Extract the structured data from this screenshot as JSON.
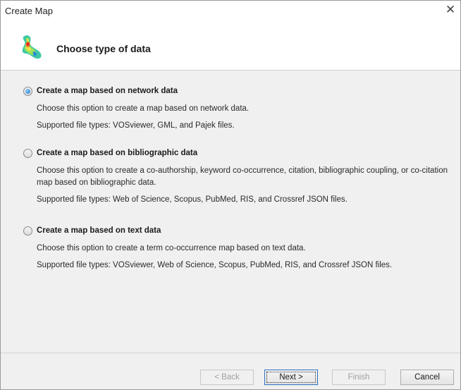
{
  "window": {
    "title": "Create Map",
    "close_glyph": "✕"
  },
  "header": {
    "title": "Choose type of data",
    "icon": "vosviewer-density-icon"
  },
  "options": [
    {
      "label": "Create a map based on network data",
      "checked": true,
      "description": "Choose this option to create a map based on network data.",
      "supported": "Supported file types: VOSviewer, GML, and Pajek files."
    },
    {
      "label": "Create a map based on bibliographic data",
      "checked": false,
      "description": "Choose this option to create a co-authorship, keyword co-occurrence, citation, bibliographic coupling, or co-citation map based on bibliographic data.",
      "supported": "Supported file types: Web of Science, Scopus, PubMed, RIS, and Crossref JSON files."
    },
    {
      "label": "Create a map based on text data",
      "checked": false,
      "description": "Choose this option to create a term co-occurrence map based on text data.",
      "supported": "Supported file types: VOSviewer, Web of Science, Scopus, PubMed, RIS, and Crossref JSON files."
    }
  ],
  "buttons": {
    "back": "< Back",
    "next": "Next >",
    "finish": "Finish",
    "cancel": "Cancel"
  },
  "colors": {
    "accent": "#1c6fc8",
    "content_bg": "#f0f0f0"
  }
}
